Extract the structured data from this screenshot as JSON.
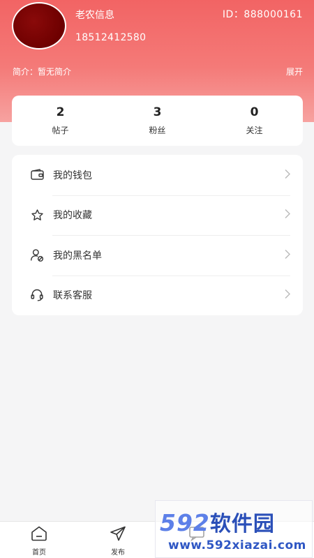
{
  "profile": {
    "name": "老农信息",
    "phone": "18512412580",
    "id_label": "ID：888000161",
    "bio": "简介：暂无简介",
    "expand": "展开"
  },
  "stats": [
    {
      "value": "2",
      "label": "帖子"
    },
    {
      "value": "3",
      "label": "粉丝"
    },
    {
      "value": "0",
      "label": "关注"
    }
  ],
  "menu": [
    {
      "label": "我的钱包",
      "icon": "wallet-icon"
    },
    {
      "label": "我的收藏",
      "icon": "star-icon"
    },
    {
      "label": "我的黑名单",
      "icon": "blacklist-user-icon"
    },
    {
      "label": "联系客服",
      "icon": "headset-icon"
    }
  ],
  "tabbar": [
    {
      "label": "首页",
      "icon": "home-icon"
    },
    {
      "label": "发布",
      "icon": "send-icon"
    }
  ],
  "watermark": {
    "title_digits": "592",
    "title_cn": "软件园",
    "url": "www.592xiazai.com"
  },
  "colors": {
    "header_top": "#f26464",
    "header_bottom": "#f7a2a0",
    "avatar": "#6e0000",
    "background": "#f5f5f6"
  }
}
